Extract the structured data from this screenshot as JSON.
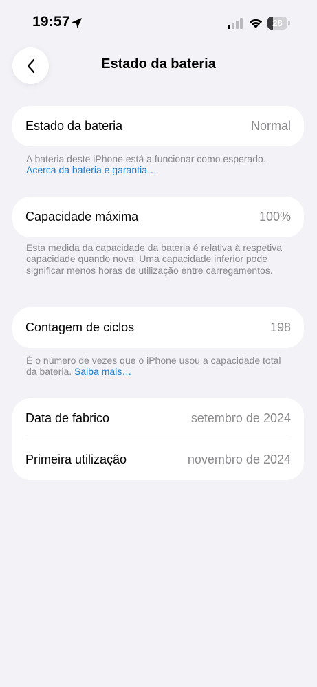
{
  "status_bar": {
    "time": "19:57",
    "battery_level": "28",
    "battery_fraction": 0.28
  },
  "header": {
    "title": "Estado da bateria"
  },
  "battery_health": {
    "label": "Estado da bateria",
    "value": "Normal",
    "footnote": "A bateria deste iPhone está a funcionar como esperado.",
    "link": "Acerca da bateria e garantia…"
  },
  "max_capacity": {
    "label": "Capacidade máxima",
    "value": "100%",
    "footnote": "Esta medida da capacidade da bateria é relativa à respetiva capacidade quando nova. Uma capacidade inferior pode significar menos horas de utilização entre carregamentos."
  },
  "cycle_count": {
    "label": "Contagem de ciclos",
    "value": "198",
    "footnote": "É o número de vezes que o iPhone usou a capacidade total da bateria.",
    "link": "Saiba mais…"
  },
  "dates": {
    "manufacture_label": "Data de fabrico",
    "manufacture_value": "setembro de 2024",
    "first_use_label": "Primeira utilização",
    "first_use_value": "novembro de 2024"
  },
  "colors": {
    "background": "#f2f2f7",
    "card": "#ffffff",
    "secondary_text": "#8a8a8e",
    "link": "#1a7fd4"
  }
}
